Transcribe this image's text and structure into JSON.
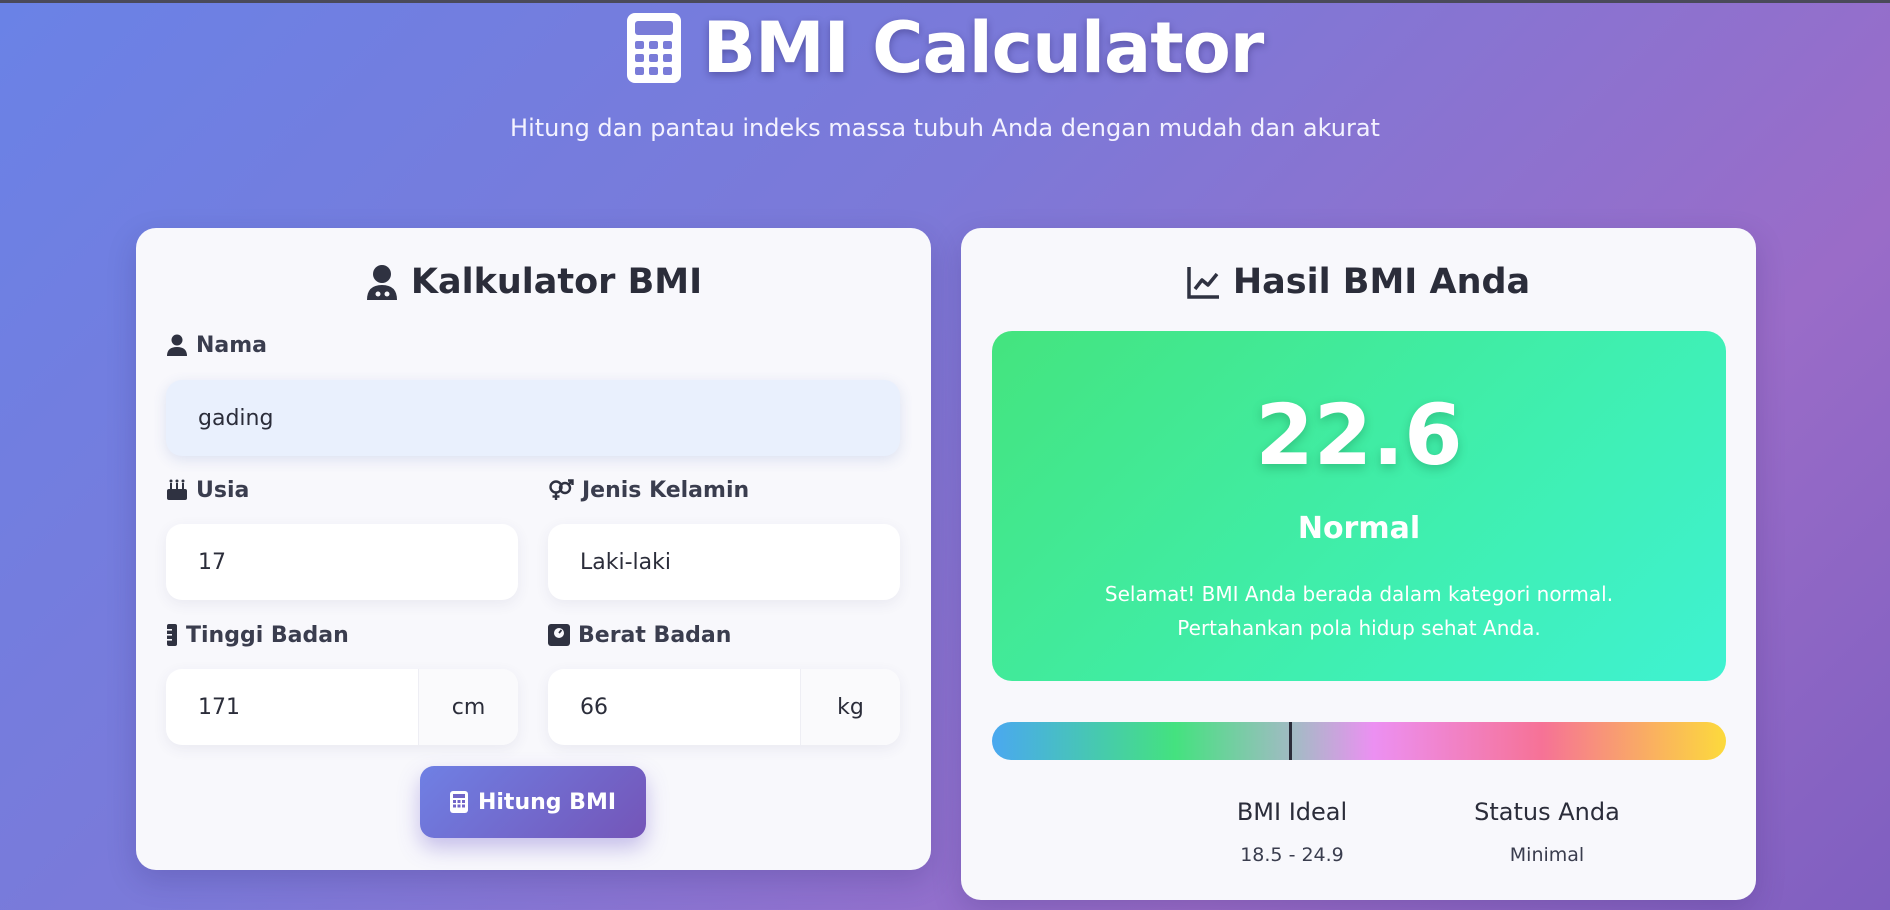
{
  "header": {
    "title": "BMI Calculator",
    "subtitle": "Hitung dan pantau indeks massa tubuh Anda dengan mudah dan akurat"
  },
  "form": {
    "title": "Kalkulator BMI",
    "name_label": "Nama",
    "name_value": "gading",
    "age_label": "Usia",
    "age_value": "17",
    "gender_label": "Jenis Kelamin",
    "gender_value": "Laki-laki",
    "height_label": "Tinggi Badan",
    "height_value": "171",
    "height_unit": "cm",
    "weight_label": "Berat Badan",
    "weight_value": "66",
    "weight_unit": "kg",
    "submit_label": "Hitung BMI"
  },
  "result": {
    "title": "Hasil BMI Anda",
    "bmi_value": "22.6",
    "category": "Normal",
    "message_line1": "Selamat! BMI Anda berada dalam kategori normal.",
    "message_line2": "Pertahankan pola hidup sehat Anda.",
    "scale_position": 0.406,
    "ideal_label": "BMI Ideal",
    "ideal_value": "18.5 - 24.9",
    "status_label": "Status Anda",
    "status_value": "Minimal"
  },
  "colors": {
    "result_green": "#44e47e",
    "button_start": "#6f80e4",
    "button_end": "#7455b8"
  },
  "icons": [
    "calculator-icon",
    "user-doctor-icon",
    "user-icon",
    "cake-icon",
    "gender-icon",
    "ruler-icon",
    "weight-scale-icon",
    "chart-line-icon"
  ]
}
